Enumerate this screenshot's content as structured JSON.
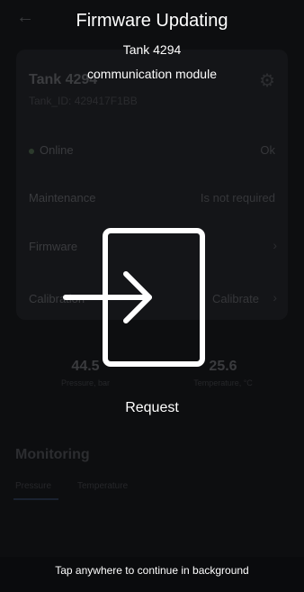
{
  "overlay": {
    "title": "Firmware Updating",
    "tank_name": "Tank 4294",
    "module": "communication module",
    "status": "Request",
    "bottom_hint": "Tap anywhere to continue in background"
  },
  "background": {
    "card": {
      "tank_title": "Tank 4294",
      "tank_id": "Tank_ID: 429417F1BB",
      "rows": [
        {
          "label": "Online",
          "value": "Ok"
        },
        {
          "label": "Maintenance",
          "value": "Is not required"
        },
        {
          "label": "Firmware",
          "value": ""
        },
        {
          "label": "Calibration",
          "value": "Calibrate"
        }
      ]
    },
    "metrics": [
      {
        "value": "44.5",
        "caption": "Pressure, bar"
      },
      {
        "value": "25.6",
        "caption": "Temperature, °C"
      }
    ],
    "monitoring": {
      "title": "Monitoring",
      "tabs": [
        "Pressure",
        "Temperature"
      ]
    }
  },
  "icons": {
    "back": "back-arrow-icon",
    "settings": "gear-icon",
    "update": "enter-door-icon"
  }
}
